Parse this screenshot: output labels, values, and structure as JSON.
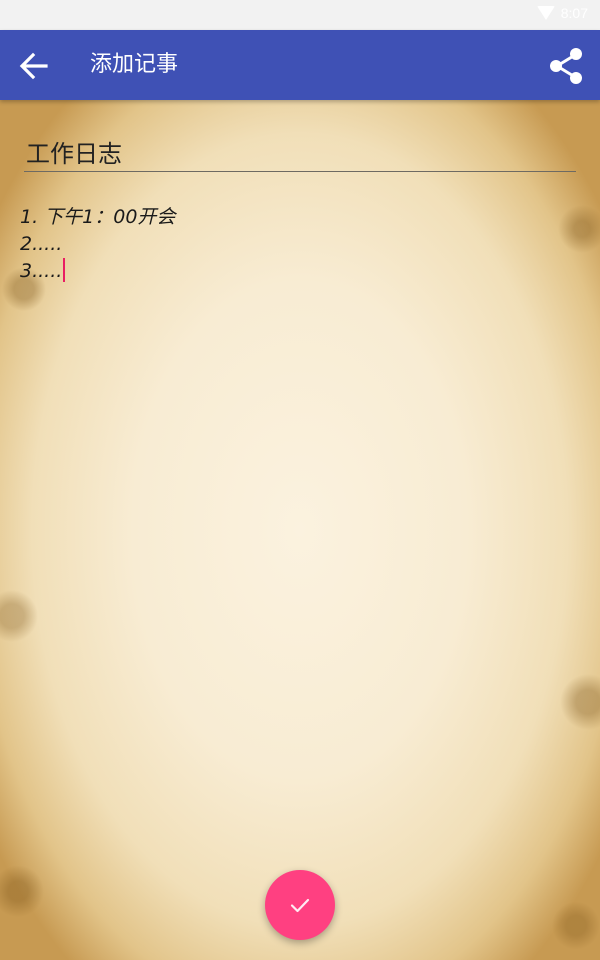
{
  "status_bar": {
    "time": "8:07"
  },
  "app_bar": {
    "title": "添加记事",
    "back_icon": "arrow-left-icon",
    "share_icon": "share-icon"
  },
  "note": {
    "title_value": "工作日志",
    "content_lines": [
      "1. 下午1：00开会",
      "2.....",
      "3....."
    ]
  },
  "fab": {
    "icon": "check-icon"
  },
  "colors": {
    "app_bar": "#3f51b5",
    "accent": "#ff4081",
    "cursor": "#e91e63"
  }
}
